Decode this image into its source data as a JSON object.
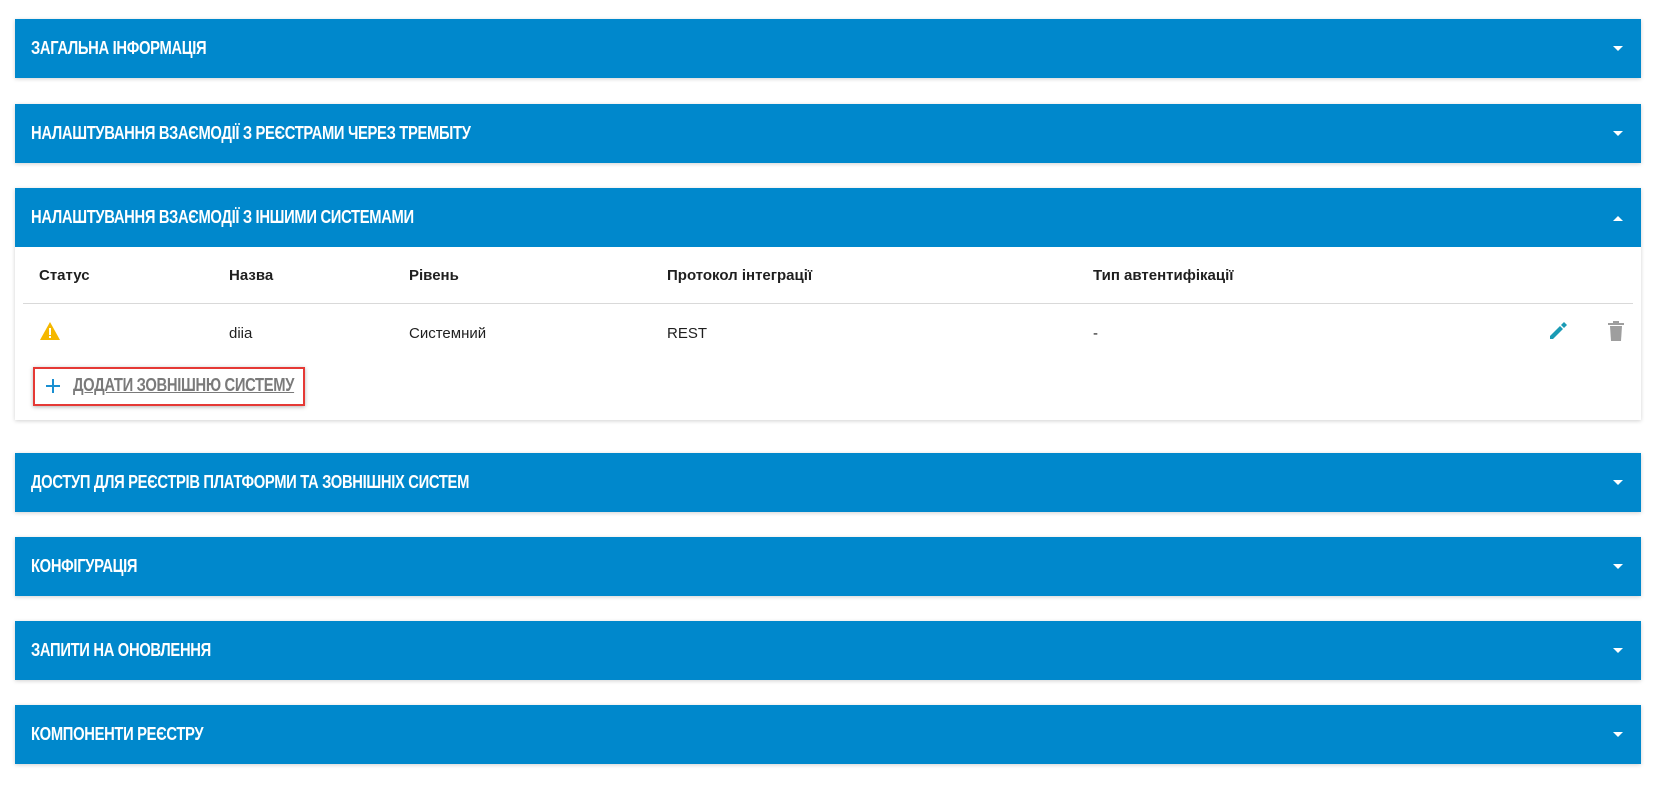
{
  "colors": {
    "header": "#0088cc",
    "warning": "#f5b800",
    "edit": "#1a9bb5",
    "delete": "#9e9e9e",
    "highlight": "#e53935"
  },
  "panels": [
    {
      "title": "ЗАГАЛЬНА ІНФОРМАЦІЯ",
      "expanded": false,
      "icon": "chevron-down-icon"
    },
    {
      "title": "НАЛАШТУВАННЯ ВЗАЄМОДІЇ З РЕЄСТРАМИ ЧЕРЕЗ ТРЕМБІТУ",
      "expanded": false,
      "icon": "chevron-down-icon"
    },
    {
      "title": "НАЛАШТУВАННЯ ВЗАЄМОДІЇ З ІНШИМИ СИСТЕМАМИ",
      "expanded": true,
      "icon": "chevron-up-icon"
    },
    {
      "title": "ДОСТУП ДЛЯ РЕЄСТРІВ ПЛАТФОРМИ ТА ЗОВНІШНІХ СИСТЕМ",
      "expanded": false,
      "icon": "chevron-down-icon"
    },
    {
      "title": "КОНФІГУРАЦІЯ",
      "expanded": false,
      "icon": "chevron-down-icon"
    },
    {
      "title": "ЗАПИТИ НА ОНОВЛЕННЯ",
      "expanded": false,
      "icon": "chevron-down-icon"
    },
    {
      "title": "КОМПОНЕНТИ РЕЄСТРУ",
      "expanded": false,
      "icon": "chevron-down-icon"
    }
  ],
  "table": {
    "columns": [
      "Статус",
      "Назва",
      "Рівень",
      "Протокол інтеграції",
      "Тип автентифікації"
    ],
    "rows": [
      {
        "status_icon": "warning-icon",
        "name": "diia",
        "level": "Системний",
        "protocol": "REST",
        "auth": "-",
        "edit_icon": "pencil-icon",
        "delete_icon": "trash-icon"
      }
    ]
  },
  "add_button": {
    "label": "ДОДАТИ ЗОВНІШНЮ СИСТЕМУ",
    "icon": "plus-icon"
  }
}
